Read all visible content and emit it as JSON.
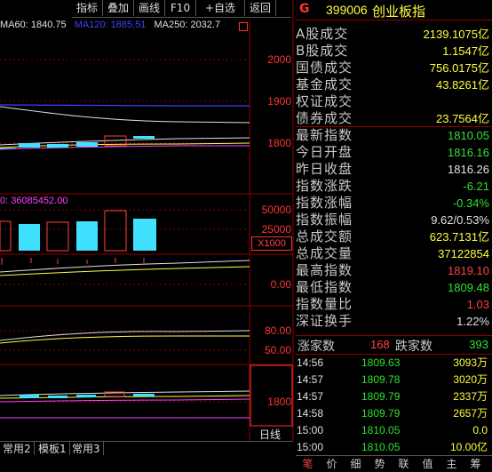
{
  "toolbar": {
    "buttons": [
      "指标",
      "叠加",
      "画线",
      "F10",
      "+自选",
      "返回"
    ]
  },
  "legend": {
    "ma60": "MA60: 1840.75",
    "ma120": "MA120: 1885.51",
    "ma250": "MA250: 2032.7"
  },
  "price_axis": [
    "2000",
    "1900",
    "1800"
  ],
  "volume_legend": "0: 36085452.00",
  "volume_axis": [
    "50000",
    "25000"
  ],
  "volume_unit": "X1000",
  "macd_axis": [
    "0.00"
  ],
  "kdj_axis": [
    "80.00",
    "50.00"
  ],
  "lower_axis": [
    "1800"
  ],
  "period_label": "日线",
  "bottom_tabs": [
    "常用2",
    "模板1",
    "常用3"
  ],
  "index": {
    "logo": "G",
    "code": "399006",
    "name": "创业板指"
  },
  "stats": [
    {
      "label": "A股成交",
      "value": "2139.1075亿",
      "color": "yellow"
    },
    {
      "label": "B股成交",
      "value": "1.1547亿",
      "color": "yellow"
    },
    {
      "label": "国债成交",
      "value": "756.0175亿",
      "color": "yellow"
    },
    {
      "label": "基金成交",
      "value": "43.8261亿",
      "color": "yellow"
    },
    {
      "label": "权证成交",
      "value": "",
      "color": "yellow"
    },
    {
      "label": "债券成交",
      "value": "23.7564亿",
      "color": "yellow"
    },
    {
      "label": "最新指数",
      "value": "1810.05",
      "color": "green"
    },
    {
      "label": "今日开盘",
      "value": "1816.16",
      "color": "green"
    },
    {
      "label": "昨日收盘",
      "value": "1816.26",
      "color": "white"
    },
    {
      "label": "指数涨跌",
      "value": "-6.21",
      "color": "green"
    },
    {
      "label": "指数涨幅",
      "value": "-0.34%",
      "color": "green"
    },
    {
      "label": "指数振幅",
      "value": "9.62/0.53%",
      "color": "white"
    },
    {
      "label": "总成交额",
      "value": "623.7131亿",
      "color": "yellow"
    },
    {
      "label": "总成交量",
      "value": "37122854",
      "color": "yellow"
    },
    {
      "label": "最高指数",
      "value": "1819.10",
      "color": "red"
    },
    {
      "label": "最低指数",
      "value": "1809.48",
      "color": "green"
    },
    {
      "label": "指数量比",
      "value": "1.03",
      "color": "red"
    },
    {
      "label": "深证换手",
      "value": "1.22%",
      "color": "white"
    }
  ],
  "updown": {
    "up_label": "涨家数",
    "up_value": "168",
    "down_label": "跌家数",
    "down_value": "393"
  },
  "ticks": [
    {
      "time": "14:56",
      "price": "1809.63",
      "volume": "3093万"
    },
    {
      "time": "14:57",
      "price": "1809.78",
      "volume": "3020万"
    },
    {
      "time": "14:57",
      "price": "1809.79",
      "volume": "2337万"
    },
    {
      "time": "14:58",
      "price": "1809.79",
      "volume": "2657万"
    },
    {
      "time": "15:00",
      "price": "1810.05",
      "volume": "0.0"
    },
    {
      "time": "15:00",
      "price": "1810.05",
      "volume": "10.00亿"
    }
  ],
  "nav": [
    "笔",
    "价",
    "细",
    "势",
    "联",
    "值",
    "主",
    "筹"
  ],
  "colors": {
    "red": "#ff4040",
    "green": "#30e030",
    "yellow": "#ffff40",
    "cyan": "#40e0ff",
    "grid": "#8b0000",
    "background": "#000000"
  }
}
